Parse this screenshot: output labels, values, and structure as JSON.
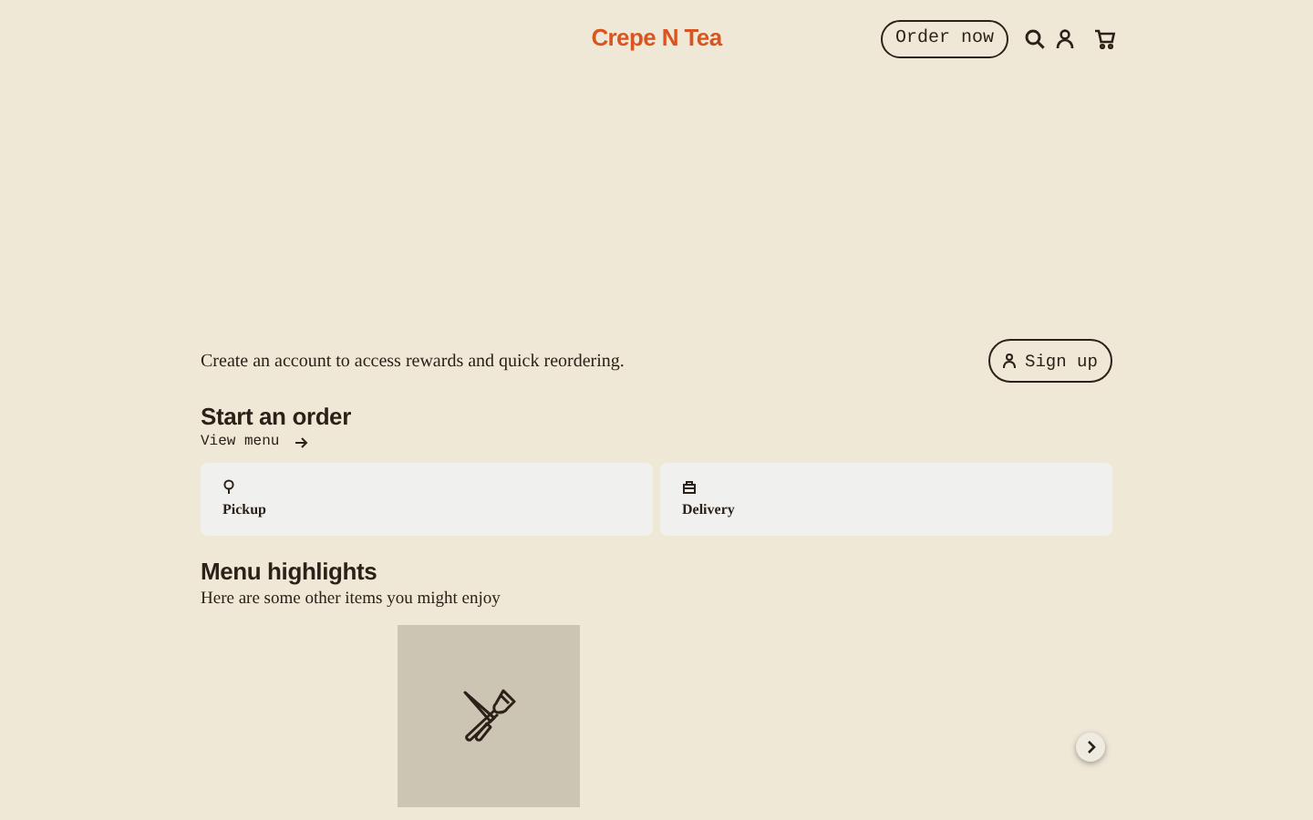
{
  "header": {
    "logo": "Crepe N Tea",
    "order_button": "Order now"
  },
  "account": {
    "text": "Create an account to access rewards and quick reordering.",
    "button": "Sign up"
  },
  "start_order": {
    "title": "Start an order",
    "link": "View menu",
    "options": [
      {
        "kind": "pickup",
        "label": "Pickup"
      },
      {
        "kind": "delivery",
        "label": "Delivery"
      }
    ]
  },
  "highlights": {
    "title": "Menu highlights",
    "subtitle": "Here are some other items you might enjoy",
    "items": [
      {
        "kind": "blank"
      },
      {
        "kind": "placeholder"
      },
      {
        "kind": "blank"
      },
      {
        "kind": "blank"
      },
      {
        "kind": "blank"
      }
    ]
  }
}
